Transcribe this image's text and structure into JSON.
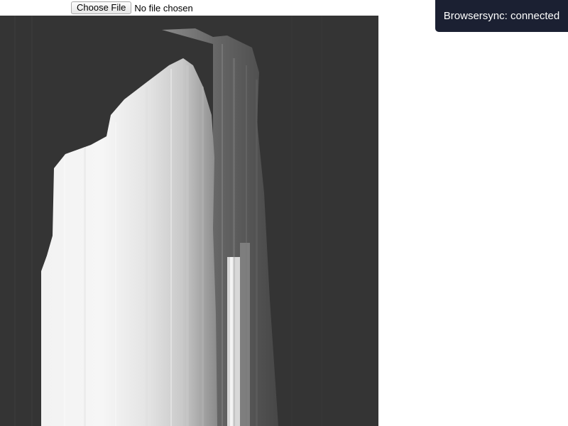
{
  "file_input": {
    "button_label": "Choose File",
    "status": "No file chosen"
  },
  "notification": {
    "text": "Browsersync: connected"
  },
  "canvas": {
    "image_description_icon": "streaked-grayscale-render",
    "background_color": "#343434"
  }
}
